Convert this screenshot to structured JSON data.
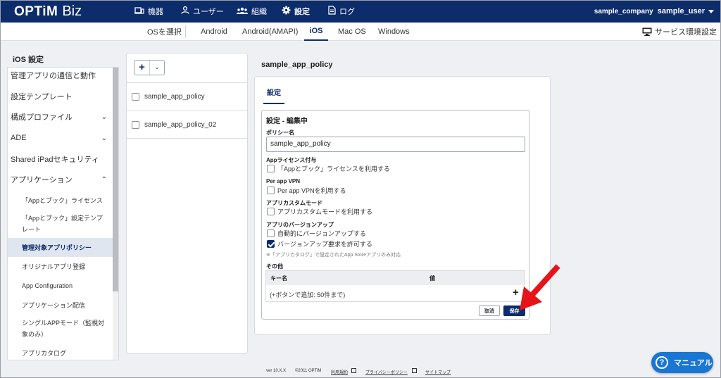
{
  "header": {
    "brand_main": "OPTiM",
    "brand_sub": "Biz",
    "nav": [
      {
        "label": "機器",
        "icon": "devices-icon"
      },
      {
        "label": "ユーザー",
        "icon": "user-icon"
      },
      {
        "label": "組織",
        "icon": "group-icon"
      },
      {
        "label": "設定",
        "icon": "gear-icon"
      },
      {
        "label": "ログ",
        "icon": "document-icon"
      }
    ],
    "company": "sample_company",
    "user": "sample_user"
  },
  "os_bar": {
    "select_label": "OSを選択",
    "tabs": [
      "Android",
      "Android(AMAPI)",
      "iOS",
      "Mac OS",
      "Windows"
    ],
    "active_tab": "iOS",
    "service_settings": "サービス環境設定"
  },
  "sidebar": {
    "title": "iOS 設定",
    "items": [
      {
        "label": "管理アプリの通信と動作"
      },
      {
        "label": "設定テンプレート"
      },
      {
        "label": "構成プロファイル",
        "chevron": "down"
      },
      {
        "label": "ADE",
        "chevron": "down"
      },
      {
        "label": "Shared iPadセキュリティ"
      },
      {
        "label": "アプリケーション",
        "chevron": "up"
      },
      {
        "label": "「Appとブック」ライセンス",
        "sub": true
      },
      {
        "label": "「Appとブック」設定テンプ",
        "label2": "レート",
        "sub": true
      },
      {
        "label": "管理対象アプリポリシー",
        "sub": true,
        "active": true
      },
      {
        "label": "オリジナルアプリ登録",
        "sub": true
      },
      {
        "label": "App Configuration",
        "sub": true
      },
      {
        "label": "アプリケーション配信",
        "sub": true
      },
      {
        "label": "シングルAPPモード（監視対",
        "label2": "象のみ）",
        "sub": true
      },
      {
        "label": "アプリカタログ",
        "sub": true
      }
    ]
  },
  "policy_list": {
    "items": [
      "sample_app_policy",
      "sample_app_policy_02"
    ]
  },
  "detail": {
    "title": "sample_app_policy",
    "tab": "設定",
    "form_heading": "設定 - 編集中",
    "policy_name_label": "ポリシー名",
    "policy_name_value": "sample_app_policy",
    "license_label": "Appライセンス付与",
    "license_option": "「Appとブック」ライセンスを利用する",
    "vpn_label": "Per app VPN",
    "vpn_option": "Per app VPNを利用する",
    "custom_label": "アプリカスタムモード",
    "custom_option": "アプリカスタムモードを利用する",
    "update_label": "アプリのバージョンアップ",
    "update_auto": "自動的にバージョンアップする",
    "update_allow": "バージョンアップ要求を許可する",
    "update_allow_checked": true,
    "update_note": "※「アプリカタログ」で設定されたApp Storeアプリのみ対応",
    "other_label": "その他",
    "col_key": "キー名",
    "col_value": "値",
    "add_hint": "(+ボタンで追加: 50件まで)",
    "cancel": "取消",
    "save": "保存"
  },
  "footer": {
    "version": "ver 10.X.X",
    "copyright": "©2011 OPTiM",
    "terms": "利用規約",
    "privacy": "プライバシーポリシー",
    "sitemap": "サイトマップ"
  },
  "manual_button": "マニュアル",
  "colors": {
    "navy": "#0d2c6b",
    "accent_blue": "#1976d2",
    "arrow": "#e5141b"
  }
}
